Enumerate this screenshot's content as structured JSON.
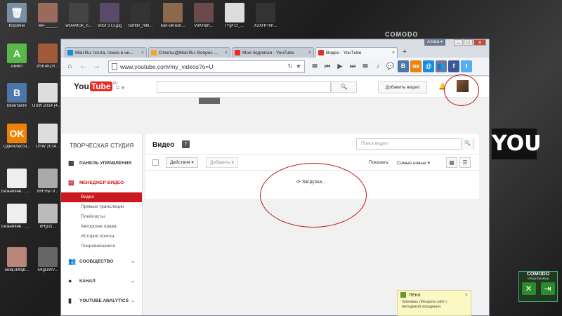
{
  "desktop": {
    "icons": [
      {
        "label": "Корзина",
        "color": "#7a8fa3",
        "glyph": "🗑"
      },
      {
        "label": "we-_____",
        "color": "#9a6a5a",
        "glyph": ""
      },
      {
        "label": "wOvwfGk_n...",
        "color": "#444",
        "glyph": ""
      },
      {
        "label": "V85F3T3.jpg",
        "color": "#5a4a6a",
        "glyph": ""
      },
      {
        "label": "tumblr_mkl...",
        "color": "#333",
        "glyph": ""
      },
      {
        "label": "kak-ukrasit...",
        "color": "#8a6a4a",
        "glyph": ""
      },
      {
        "label": "VoKHdrt...",
        "color": "#6a4a4a",
        "glyph": ""
      },
      {
        "label": "IYgFEf_...",
        "color": "#ddd",
        "glyph": ""
      },
      {
        "label": "X3XHFmh...",
        "color": "#333",
        "glyph": ""
      },
      {
        "label": "Амиго",
        "color": "#5ab84a",
        "glyph": "A"
      },
      {
        "label": "dSK4bZR...",
        "color": "#a05a3a",
        "glyph": ""
      },
      {
        "label": "Вконтакте",
        "color": "#4a76a8",
        "glyph": "B"
      },
      {
        "label": "USW 2014 (4).jpg",
        "color": "#ddd",
        "glyph": ""
      },
      {
        "label": "Одноклассн...",
        "color": "#ee8208",
        "glyph": "OK"
      },
      {
        "label": "USW 2014...",
        "color": "#ddd",
        "glyph": ""
      },
      {
        "label": "Безымянн... 2014-05-...",
        "color": "#eee",
        "glyph": ""
      },
      {
        "label": "8hFHaT9...",
        "color": "#aaa",
        "glyph": ""
      },
      {
        "label": "Безымянн... 2014-05-...",
        "color": "#eee",
        "glyph": ""
      },
      {
        "label": "8HgIzt...",
        "color": "#bbb",
        "glyph": ""
      },
      {
        "label": "Безымянн... 2014-05-...",
        "color": "#eee",
        "glyph": ""
      },
      {
        "label": "GhqE8Ir...",
        "color": "#aaa",
        "glyph": ""
      },
      {
        "label": "5b8ij1Mfqb...",
        "color": "#b8857a",
        "glyph": ""
      },
      {
        "label": "lVtgtJWV...",
        "color": "#666",
        "glyph": ""
      }
    ],
    "comodo_top": "COMODO",
    "you_logo": "YOU",
    "comodo_panel": {
      "title": "COMODO",
      "subtitle": "Virtual Desktop"
    }
  },
  "browser": {
    "user_badge": "Алиса ▾",
    "tabs": [
      {
        "title": "Mail.Ru: почта, поиск в ин...",
        "color": "#168de2"
      },
      {
        "title": "Ответы@Mail.Ru: Вопрос ...",
        "color": "#f5a623"
      },
      {
        "title": "Мои подписки - YouTube",
        "color": "#e52d27"
      },
      {
        "title": "Видео - YouTube",
        "color": "#e52d27"
      }
    ],
    "url": "www.youtube.com/my_videos?o=U",
    "extensions": [
      {
        "name": "mail-ext-icon",
        "label": "✉",
        "bg": "transparent"
      },
      {
        "name": "music-icon",
        "label": "♪",
        "bg": "transparent"
      },
      {
        "name": "chat-icon",
        "label": "💬",
        "bg": "transparent"
      },
      {
        "name": "vk-icon",
        "label": "B",
        "bg": "#4a76a8"
      },
      {
        "name": "ok-icon",
        "label": "ок",
        "bg": "#ee8208"
      },
      {
        "name": "mail-ru-icon",
        "label": "@",
        "bg": "#168de2"
      },
      {
        "name": "friends-icon",
        "label": "👥",
        "bg": "#6a7a9a"
      },
      {
        "name": "facebook-icon",
        "label": "f",
        "bg": "#3b5998"
      },
      {
        "name": "twitter-icon",
        "label": "t",
        "bg": "#55acee"
      }
    ]
  },
  "youtube": {
    "logo_you": "You",
    "logo_tube": "Tube",
    "logo_region": "RU",
    "upload_label": "Добавить видео",
    "studio_title": "ТВОРЧЕСКАЯ СТУДИЯ",
    "nav": {
      "dashboard": "ПАНЕЛЬ УПРАВЛЕНИЯ",
      "video_manager": "МЕНЕДЖЕР ВИДЕО",
      "sub": [
        "Видео",
        "Прямые трансляции",
        "Плейлисты",
        "Авторские права",
        "История поиска",
        "Понравившиеся"
      ],
      "community": "СООБЩЕСТВО",
      "channel": "КАНАЛ",
      "analytics": "YOUTUBE ANALYTICS"
    },
    "videos_title": "Видео",
    "videos_count": "7",
    "search_placeholder": "Поиск видео",
    "actions_label": "Действия ▾",
    "add_to_label": "Добавить в",
    "show_label": "Показать:",
    "sort_label": "Самые новые ▾",
    "loading_text": "Загрузка..."
  },
  "sticky": {
    "name": "Лена",
    "text": "помнишь обещала сайт с методикой похудения"
  }
}
